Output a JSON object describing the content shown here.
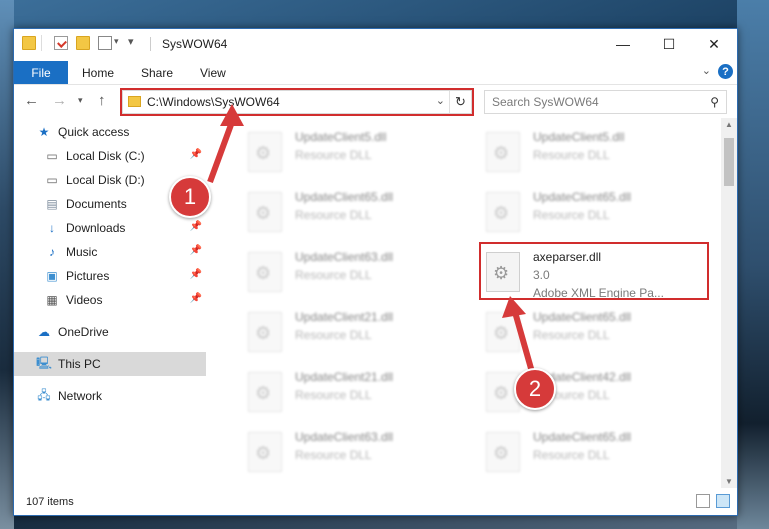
{
  "window": {
    "title": "SysWOW64",
    "controls": {
      "minimize": "—",
      "maximize": "☐",
      "close": "✕"
    }
  },
  "ribbon": {
    "tabs": [
      {
        "label": "File",
        "active": true
      },
      {
        "label": "Home"
      },
      {
        "label": "Share"
      },
      {
        "label": "View"
      }
    ],
    "help": "?"
  },
  "nav": {
    "address": "C:\\Windows\\SysWOW64",
    "search_placeholder": "Search SysWOW64"
  },
  "sidebar": {
    "items": [
      {
        "label": "Quick access",
        "icon": "star-icon",
        "pinned": false
      },
      {
        "label": "Local Disk (C:)",
        "icon": "drive-icon",
        "pinned": true
      },
      {
        "label": "Local Disk (D:)",
        "icon": "drive-icon",
        "pinned": false
      },
      {
        "label": "Documents",
        "icon": "documents-icon",
        "pinned": true
      },
      {
        "label": "Downloads",
        "icon": "downloads-icon",
        "pinned": true
      },
      {
        "label": "Music",
        "icon": "music-icon",
        "pinned": true
      },
      {
        "label": "Pictures",
        "icon": "pictures-icon",
        "pinned": true
      },
      {
        "label": "Videos",
        "icon": "videos-icon",
        "pinned": true
      },
      {
        "label": "OneDrive",
        "icon": "cloud-icon",
        "pinned": false
      },
      {
        "label": "This PC",
        "icon": "computer-icon",
        "pinned": false,
        "selected": true
      },
      {
        "label": "Network",
        "icon": "network-icon",
        "pinned": false
      }
    ]
  },
  "files": [
    {
      "name": "UpdateClient5.dll",
      "type": "Resource DLL"
    },
    {
      "name": "UpdateClient5.dll",
      "type": "Resource DLL"
    },
    {
      "name": "UpdateClient65.dll",
      "type": "Resource DLL"
    },
    {
      "name": "UpdateClient65.dll",
      "type": "Resource DLL"
    },
    {
      "name": "UpdateClient63.dll",
      "type": "Resource DLL"
    },
    {
      "name": "axeparser.dll",
      "version": "3.0",
      "description": "Adobe XML Engine Pa...",
      "highlighted": true
    },
    {
      "name": "UpdateClient21.dll",
      "type": "Resource DLL"
    },
    {
      "name": "UpdateClient65.dll",
      "type": "Resource DLL"
    },
    {
      "name": "UpdateClient21.dll",
      "type": "Resource DLL"
    },
    {
      "name": "UpdateClient42.dll",
      "type": "Resource DLL"
    },
    {
      "name": "UpdateClient63.dll",
      "type": "Resource DLL"
    },
    {
      "name": "UpdateClient65.dll",
      "type": "Resource DLL"
    }
  ],
  "status": {
    "count": "107 items"
  },
  "callouts": [
    "1",
    "2"
  ],
  "colors": {
    "accent": "#1a6fc4",
    "highlight": "#d12d2d",
    "badge": "#d63a3a"
  }
}
